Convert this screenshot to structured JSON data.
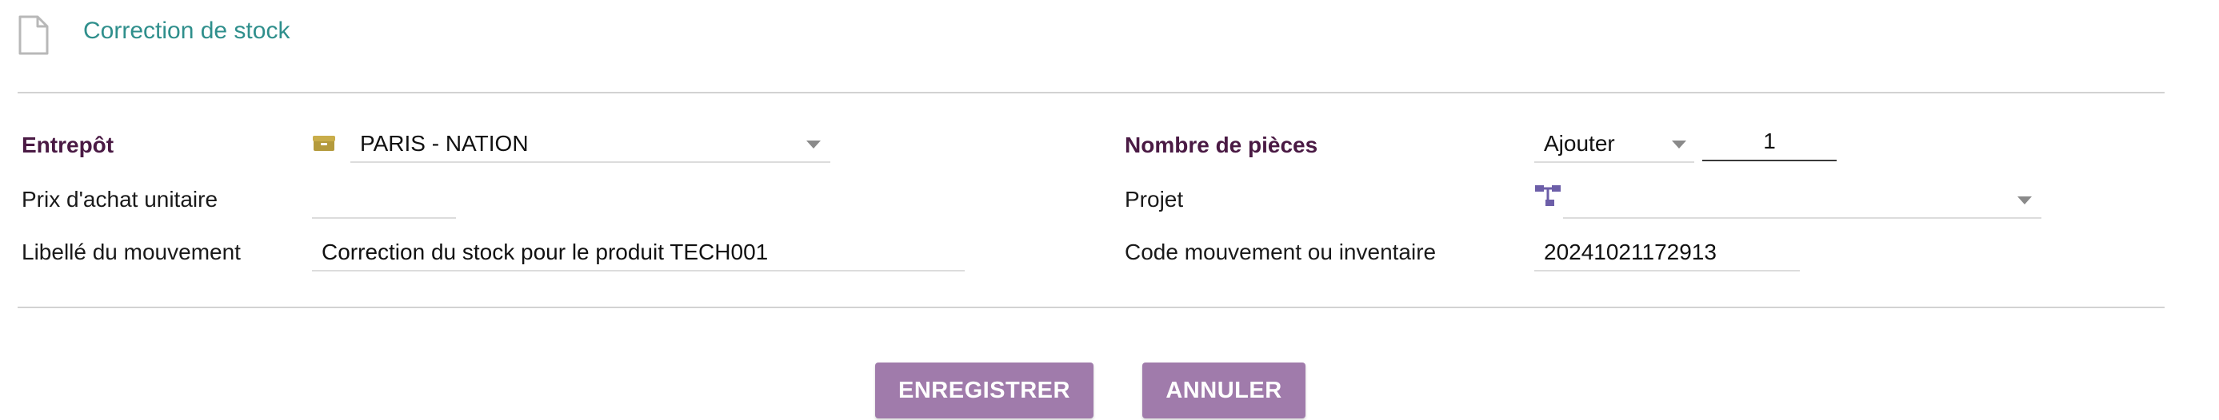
{
  "header": {
    "title": "Correction de stock",
    "icon": "document-icon"
  },
  "form": {
    "entrepot": {
      "label": "Entrepôt",
      "value": "PARIS - NATION",
      "icon": "box-icon",
      "icon_color": "#b49a3c"
    },
    "prix": {
      "label": "Prix d'achat unitaire",
      "value": ""
    },
    "libelle": {
      "label": "Libellé du mouvement",
      "value": "Correction du stock pour le produit TECH001"
    },
    "nombre": {
      "label": "Nombre de pièces",
      "operation": "Ajouter",
      "quantity": "1"
    },
    "projet": {
      "label": "Projet",
      "value": "",
      "icon": "project-tree-icon",
      "icon_color": "#6c5ea8"
    },
    "code": {
      "label": "Code mouvement ou inventaire",
      "value": "20241021172913"
    }
  },
  "actions": {
    "save_label": "ENREGISTRER",
    "cancel_label": "ANNULER",
    "button_color": "#a07bab"
  },
  "colors": {
    "title": "#2f8f8c",
    "bold_label": "#4a1a44"
  }
}
